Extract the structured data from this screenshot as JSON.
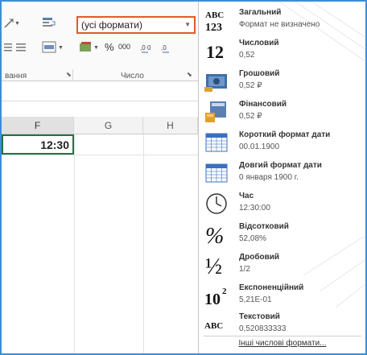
{
  "ribbon": {
    "number_format_value": "(усі формати)",
    "number_group_label": "Число",
    "alignment_group_label_partial": "вання",
    "percent_symbol": "%",
    "thousands_symbol": "000"
  },
  "sheet": {
    "columns": [
      "F",
      "G",
      "H"
    ],
    "active_cell_value": "12:30"
  },
  "formats": [
    {
      "id": "general",
      "icon": "abc-123-icon",
      "title": "Загальний",
      "sample": "Формат не визначено"
    },
    {
      "id": "number",
      "icon": "number-12-icon",
      "title": "Числовий",
      "sample": "0,52"
    },
    {
      "id": "currency",
      "icon": "currency-icon",
      "title": "Грошовий",
      "sample": "0,52 ₽"
    },
    {
      "id": "accounting",
      "icon": "accounting-icon",
      "title": "Фінансовий",
      "sample": "0,52 ₽"
    },
    {
      "id": "short-date",
      "icon": "calendar-icon",
      "title": "Короткий формат дати",
      "sample": "00.01.1900"
    },
    {
      "id": "long-date",
      "icon": "calendar-icon",
      "title": "Довгий формат дати",
      "sample": "0 января 1900 г."
    },
    {
      "id": "time",
      "icon": "clock-icon",
      "title": "Час",
      "sample": "12:30:00"
    },
    {
      "id": "percent",
      "icon": "percent-icon",
      "title": "Відсотковий",
      "sample": "52,08%"
    },
    {
      "id": "fraction",
      "icon": "fraction-icon",
      "title": "Дробовий",
      "sample": "1/2"
    },
    {
      "id": "scientific",
      "icon": "exponent-icon",
      "title": "Експоненційний",
      "sample": "5,21E-01"
    },
    {
      "id": "text",
      "icon": "abc-text-icon",
      "title": "Текстовий",
      "sample": "0,520833333"
    }
  ],
  "more_formats_label": "Інші числові формати...",
  "icon_text": {
    "abc": "ABC",
    "n123": "123",
    "n12": "12",
    "pct": "%",
    "half": "½",
    "ten": "10",
    "sup": "2",
    "abc2": "ABC"
  },
  "colors": {
    "combo_border": "#e05a2c",
    "frame": "#3a8fd8",
    "active_cell_border": "#217346"
  }
}
